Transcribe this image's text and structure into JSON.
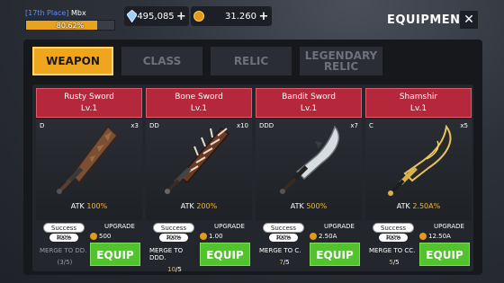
{
  "header": {
    "rank_label": "[17th Place]",
    "player_name": "Mbx",
    "exp_progress": "80.62%",
    "exp_fraction": 0.8062,
    "gems": "495,085",
    "coins": "31.260",
    "title": "EQUIPMENT",
    "close_label": "✕"
  },
  "tabs": [
    {
      "label": "WEAPON",
      "active": true
    },
    {
      "label": "CLASS",
      "active": false
    },
    {
      "label": "RELIC",
      "active": false
    },
    {
      "label": "LEGENDARY RELIC",
      "active": false
    }
  ],
  "cards": [
    {
      "name": "Rusty Sword",
      "level": "Lv.1",
      "grade": "D",
      "count": "x3",
      "atk_label": "ATK",
      "atk_value": "100%",
      "success_label": "Success Rate",
      "success_value": "100%",
      "upgrade_label": "UPGRADE",
      "upgrade_cost": "500",
      "merge_label": "MERGE TO DD.",
      "merge_current": "(3/5)",
      "merge_total": "",
      "merge_ready": false,
      "equip_label": "EQUIP",
      "icon": "rusty-sword-icon"
    },
    {
      "name": "Bone Sword",
      "level": "Lv.1",
      "grade": "DD",
      "count": "x10",
      "atk_label": "ATK",
      "atk_value": "200%",
      "success_label": "Success Rate",
      "success_value": "100%",
      "upgrade_label": "UPGRADE",
      "upgrade_cost": "1.00",
      "merge_label": "MERGE TO DDD.",
      "merge_current": "10",
      "merge_total": "/5",
      "merge_ready": true,
      "equip_label": "EQUIP",
      "icon": "bone-sword-icon"
    },
    {
      "name": "Bandit Sword",
      "level": "Lv.1",
      "grade": "DDD",
      "count": "x7",
      "atk_label": "ATK",
      "atk_value": "500%",
      "success_label": "Success Rate",
      "success_value": "100%",
      "upgrade_label": "UPGRADE",
      "upgrade_cost": "2.50A",
      "merge_label": "MERGE TO C.",
      "merge_current": "7",
      "merge_total": "/5",
      "merge_ready": true,
      "equip_label": "EQUIP",
      "icon": "bandit-sword-icon"
    },
    {
      "name": "Shamshir",
      "level": "Lv.1",
      "grade": "C",
      "count": "x5",
      "atk_label": "ATK",
      "atk_value": "2.50A%",
      "success_label": "Success Rate",
      "success_value": "100%",
      "upgrade_label": "UPGRADE",
      "upgrade_cost": "12.50A",
      "merge_label": "MERGE TO CC.",
      "merge_current": "5",
      "merge_total": "/5",
      "merge_ready": true,
      "equip_label": "EQUIP",
      "icon": "shamshir-icon"
    }
  ],
  "colors": {
    "accent": "#f0a51e",
    "card_header": "#b5283b",
    "equip_green": "#52c22e"
  }
}
